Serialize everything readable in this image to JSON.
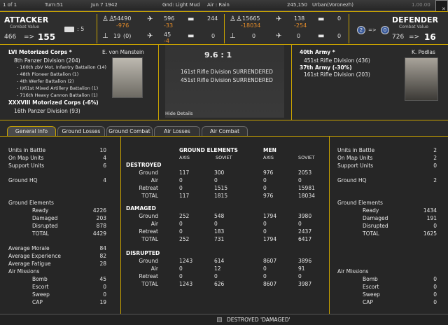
{
  "topbar": {
    "page": "1 of 1",
    "turn": "Turn:51",
    "date": "Jun 7 1942",
    "ground": "Gnd: Light Mud",
    "air": "Air : Rain",
    "coord": "245,150",
    "location": "Urban(Voronezh)",
    "ratio_small": "1.00.00"
  },
  "attacker": {
    "label": "ATTACKER",
    "cv_label": "Combat Value",
    "cv_from": "466",
    "arrow": "=>",
    "cv_to": "155",
    "hq_count": ": 5",
    "men": "54490",
    "men_loss": "-976",
    "guns": "19",
    "guns_loss": "(0)",
    "air": "596",
    "air_loss": "-33",
    "air2": "45",
    "air2_loss": "-4",
    "tanks": "244",
    "tanks2": "0"
  },
  "defender": {
    "label": "DEFENDER",
    "cv_label": "Combat Value",
    "cv_from": "726",
    "arrow": "=>",
    "cv_to": "16",
    "badge_a": "2",
    "badge_b": "0",
    "men": "15665",
    "men_loss": "-18034",
    "guns": "0",
    "air": "138",
    "air_loss": "-254",
    "air2": "0",
    "tanks": "0",
    "tanks2": "0"
  },
  "cmdr_left": {
    "corps1": "LVI Motorized Corps *",
    "commander": "E. von Manstein",
    "div1": "8th Panzer Division (204)",
    "units": [
      "- 100th zbV Mot. Infantry Battalion (14)",
      "- 48th Pioneer Battalion (1)",
      "- 4th Werfer Battalion (2)",
      "- II/61st Mixed Artillery Battalion (1)",
      "- 716th Heavy Cannon Battalion (1)"
    ],
    "corps2": "XXXVIII Motorized Corps (-6%)",
    "div2": "16th Panzer Division (93)"
  },
  "center": {
    "ratio": "9.6 : 1",
    "msg1": "161st Rifle Division SURRENDERED",
    "msg2": "451st Rifle Division SURRENDERED",
    "hide": "Hide Details"
  },
  "cmdr_right": {
    "army1": "40th Army *",
    "commander": "K. Podlas",
    "div1": "451st Rifle Division (436)",
    "army2": "37th Army (-30%)",
    "div2": "161st Rifle Division (203)"
  },
  "tabs": [
    "General Info",
    "Ground Losses",
    "Ground Combat",
    "Air Losses",
    "Air Combat"
  ],
  "left_stats": {
    "units_in_battle": [
      "Units in Battle",
      "10"
    ],
    "on_map": [
      "On Map Units",
      "4"
    ],
    "support": [
      "Support Units",
      "6"
    ],
    "ground_hq": [
      "Ground HQ",
      "4"
    ],
    "ground_elements": "Ground Elements",
    "ready": [
      "Ready",
      "4226"
    ],
    "damaged": [
      "Damaged",
      "203"
    ],
    "disrupted": [
      "Disrupted",
      "878"
    ],
    "total": [
      "TOTAL",
      "4429"
    ],
    "morale": [
      "Average Morale",
      "84"
    ],
    "experience": [
      "Average Experience",
      "82"
    ],
    "fatigue": [
      "Average Fatigue",
      "28"
    ],
    "air_missions": "Air Missions",
    "bomb": [
      "Bomb",
      "45"
    ],
    "escort": [
      "Escort",
      "0"
    ],
    "sweep": [
      "Sweep",
      "0"
    ],
    "cap": [
      "CAP",
      "19"
    ]
  },
  "mid": {
    "h_ground": "GROUND ELEMENTS",
    "h_men": "MEN",
    "axis": "AXIS",
    "soviet": "SOVIET",
    "destroyed": "DESTROYED",
    "damaged": "DAMAGED",
    "disrupted": "DISRUPTED",
    "rowlabels": [
      "Ground",
      "Air",
      "Retreat",
      "TOTAL"
    ],
    "destroyed_rows": [
      [
        "117",
        "300",
        "976",
        "2053"
      ],
      [
        "0",
        "0",
        "0",
        "0"
      ],
      [
        "0",
        "1515",
        "0",
        "15981"
      ],
      [
        "117",
        "1815",
        "976",
        "18034"
      ]
    ],
    "damaged_rows": [
      [
        "252",
        "548",
        "1794",
        "3980"
      ],
      [
        "0",
        "0",
        "0",
        "0"
      ],
      [
        "0",
        "183",
        "0",
        "2437"
      ],
      [
        "252",
        "731",
        "1794",
        "6417"
      ]
    ],
    "disrupted_rows": [
      [
        "1243",
        "614",
        "8607",
        "3896"
      ],
      [
        "0",
        "12",
        "0",
        "91"
      ],
      [
        "0",
        "0",
        "0",
        "0"
      ],
      [
        "1243",
        "626",
        "8607",
        "3987"
      ]
    ]
  },
  "right_stats": {
    "units_in_battle": [
      "Units in Battle",
      "2"
    ],
    "on_map": [
      "On Map Units",
      "2"
    ],
    "support": [
      "Support Units",
      "0"
    ],
    "ground_hq": [
      "Ground HQ",
      "2"
    ],
    "ground_elements": "Ground Elements",
    "ready": [
      "Ready",
      "1434"
    ],
    "damaged": [
      "Damaged",
      "191"
    ],
    "disrupted": [
      "Disrupted",
      "0"
    ],
    "total": [
      "TOTAL",
      "1625"
    ],
    "air_missions": "Air Missions",
    "bomb": [
      "Bomb",
      "0"
    ],
    "escort": [
      "Escort",
      "0"
    ],
    "sweep": [
      "Sweep",
      "0"
    ],
    "cap": [
      "CAP",
      "0"
    ]
  },
  "footer": {
    "label": "DESTROYED 'DAMAGED'"
  }
}
